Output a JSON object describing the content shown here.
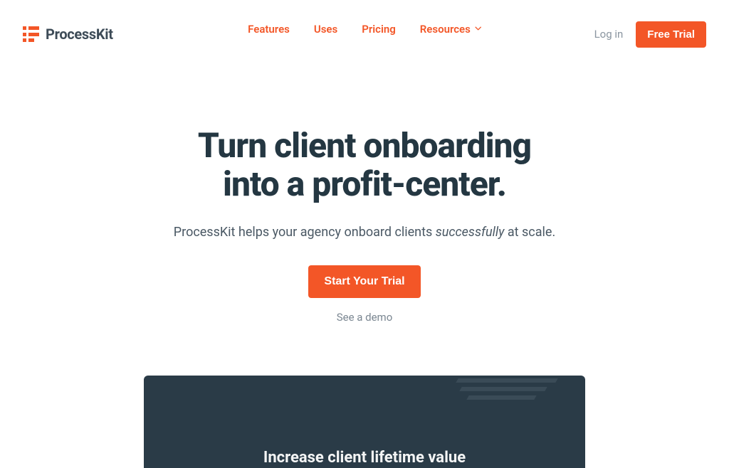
{
  "brand": {
    "name": "ProcessKit"
  },
  "nav": {
    "features": "Features",
    "uses": "Uses",
    "pricing": "Pricing",
    "resources": "Resources"
  },
  "header_actions": {
    "login": "Log in",
    "free_trial": "Free Trial"
  },
  "hero": {
    "title_line1": "Turn client onboarding",
    "title_line2": "into a profit-center.",
    "subtitle_pre": "ProcessKit helps your agency onboard clients ",
    "subtitle_em": "successfully",
    "subtitle_post": " at scale.",
    "cta_primary": "Start Your Trial",
    "cta_secondary": "See a demo"
  },
  "panel": {
    "heading": "Increase client lifetime value"
  },
  "colors": {
    "accent": "#f35627",
    "dark": "#2a3b47"
  }
}
